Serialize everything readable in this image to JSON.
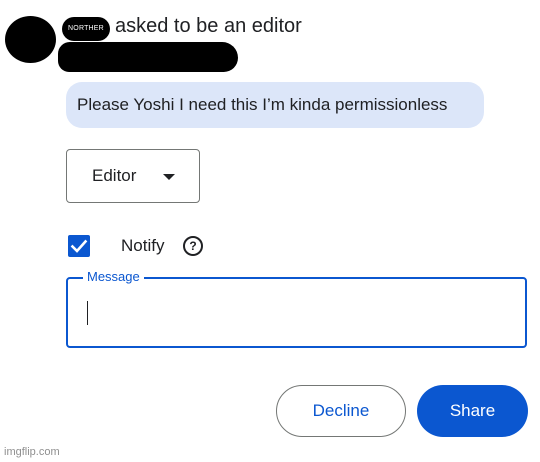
{
  "request": {
    "name_tag": "NORTHER",
    "text": "asked to be an editor"
  },
  "message_bubble": {
    "text": "Please Yoshi I need this I’m kinda permissionless"
  },
  "role_select": {
    "selected": "Editor",
    "icon": "caret-down-icon"
  },
  "notify": {
    "checked": true,
    "label": "Notify",
    "help_icon": "?"
  },
  "message_field": {
    "label": "Message",
    "value": ""
  },
  "actions": {
    "decline_label": "Decline",
    "share_label": "Share"
  },
  "colors": {
    "accent": "#0b57d0",
    "bubble": "#dce6f9",
    "outline": "#747775"
  },
  "watermark": "imgflip.com"
}
